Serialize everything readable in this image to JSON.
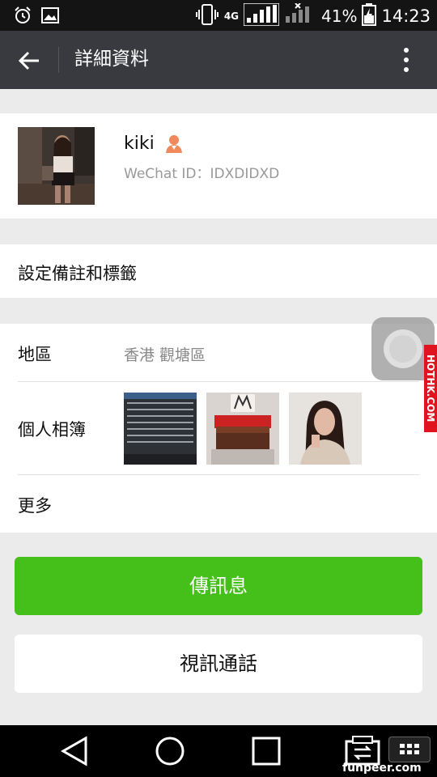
{
  "status_bar": {
    "network_4g_a": "4G",
    "network_4g_b": "4G",
    "battery": "41%",
    "time": "14:23"
  },
  "header": {
    "title": "詳細資料"
  },
  "profile": {
    "name": "kiki",
    "wechat_id": "WeChat ID：IDXDIDXD"
  },
  "remark": {
    "label": "設定備註和標籤"
  },
  "info": {
    "region_label": "地區",
    "region_value": "香港  觀塘區",
    "album_label": "個人相簿",
    "more_label": "更多"
  },
  "actions": {
    "message": "傳訊息",
    "video_call": "視訊通話"
  },
  "watermarks": {
    "side": "HOTHK.COM",
    "bottom": "funpeer.com"
  },
  "colors": {
    "header_bg": "#393a3f",
    "accent_green": "#45c01a",
    "page_bg": "#ebebeb"
  }
}
